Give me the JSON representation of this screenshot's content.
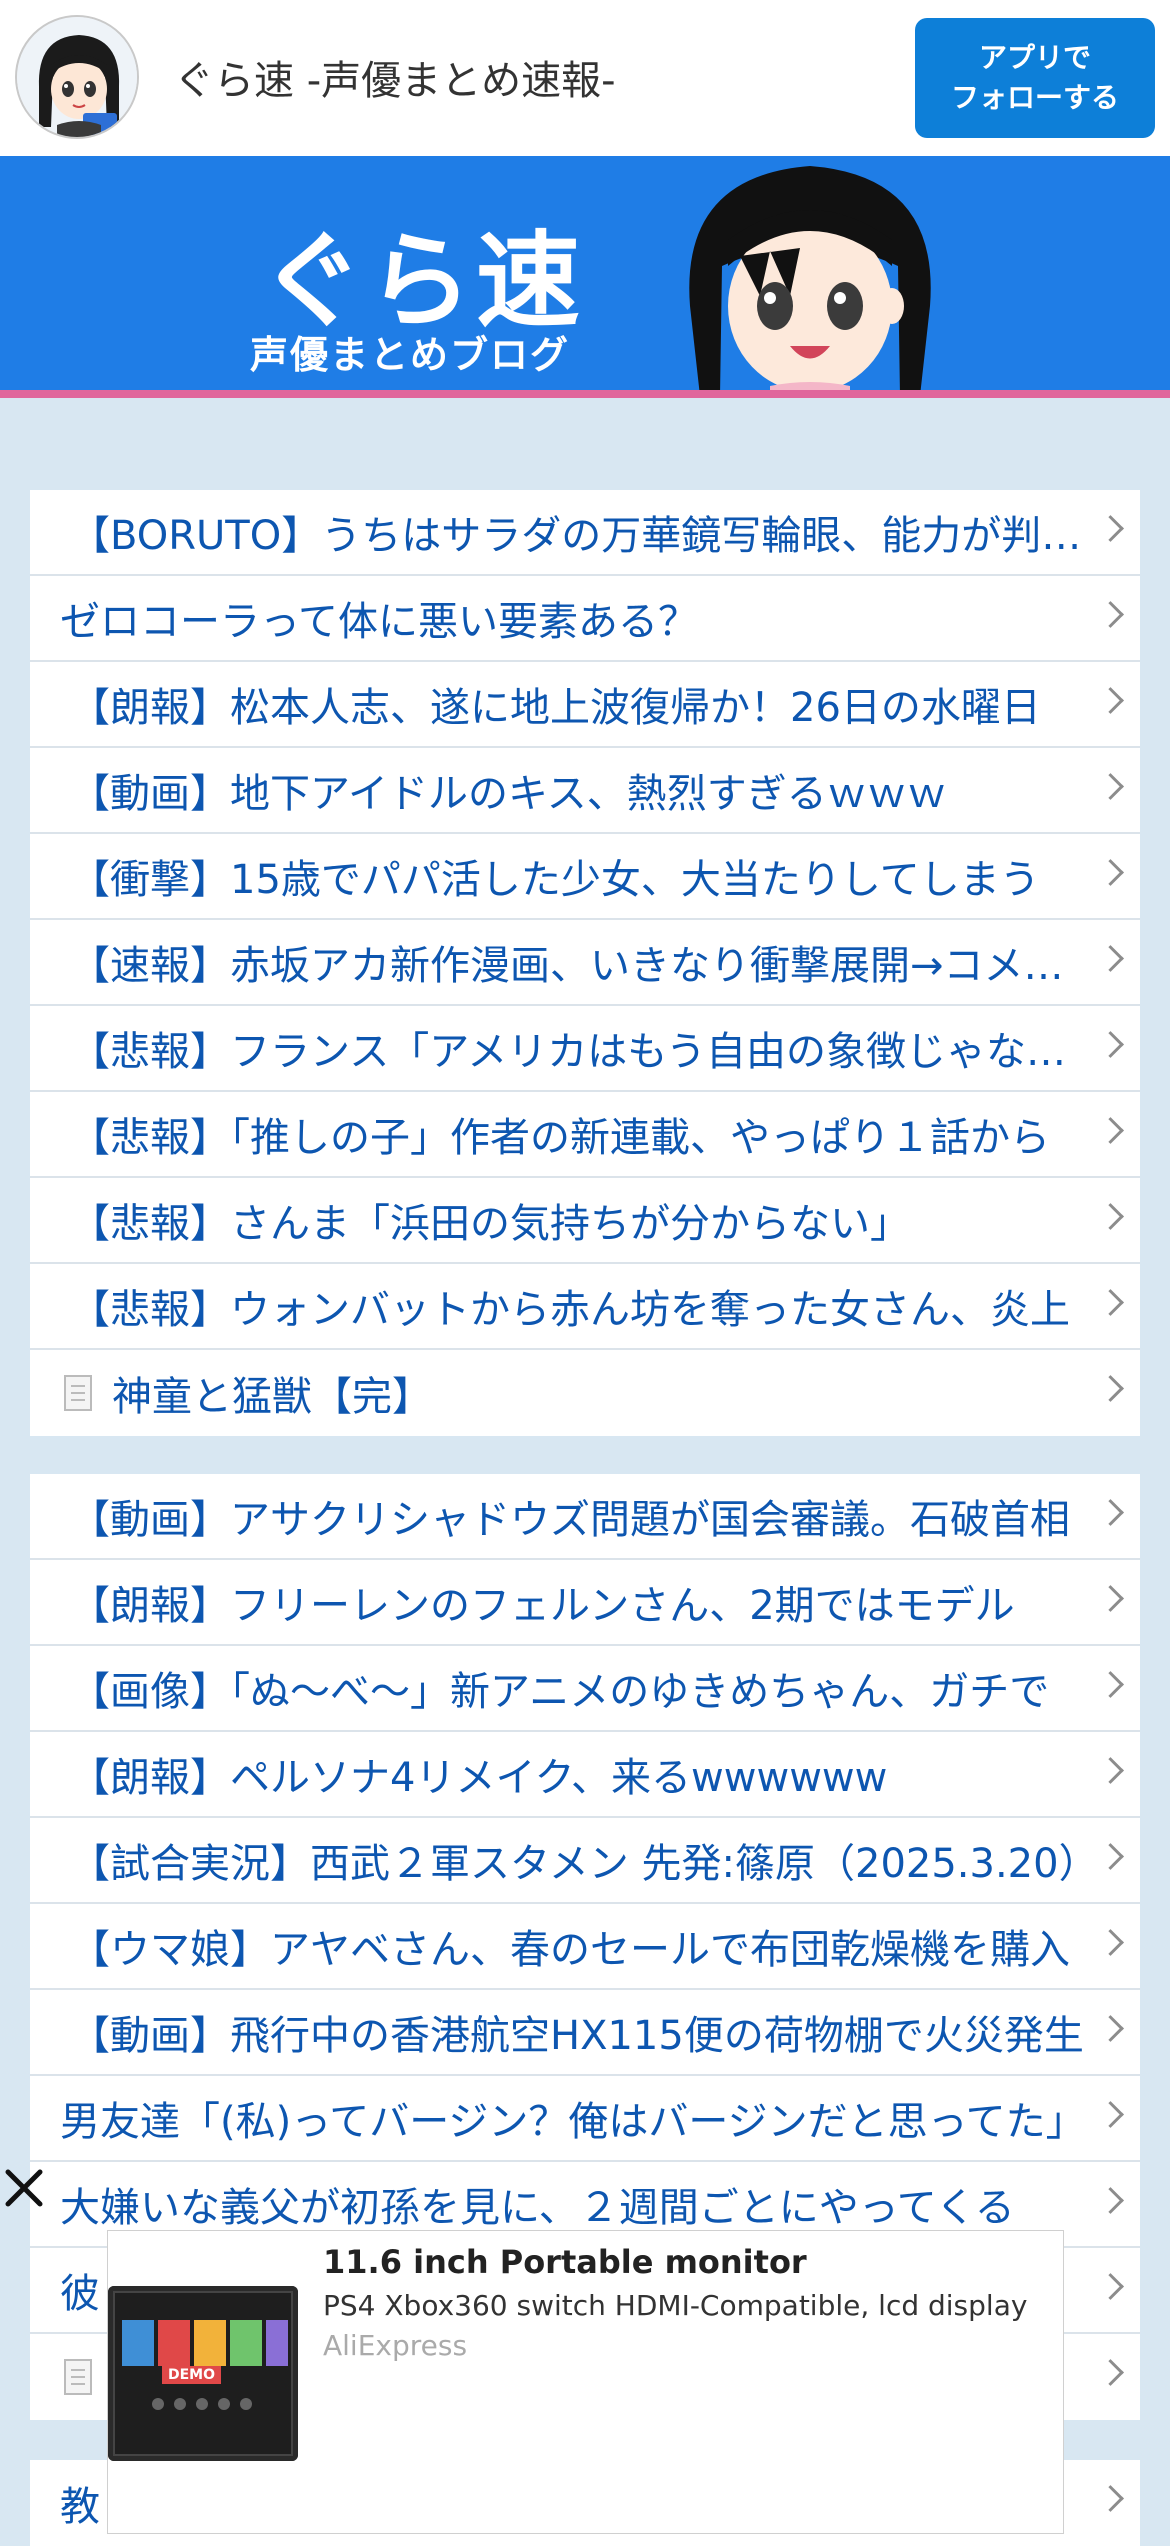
{
  "header": {
    "site_title": "ぐら速 -声優まとめ速報-",
    "follow_line1": "アプリで",
    "follow_line2": "フォローする"
  },
  "banner": {
    "logo_text": "ぐら速",
    "subtitle": "声優まとめブログ"
  },
  "list1": [
    "【BORUTO】うちはサラダの万華鏡写輪眼、能力が判明する",
    "ゼロコーラって体に悪い要素ある？",
    "【朗報】松本人志、遂に地上波復帰か！26日の水曜日",
    "【動画】地下アイドルのキス、熱烈すぎるｗｗｗ",
    "【衝撃】15歳でパパ活した少女、大当たりしてしまう",
    "【速報】赤坂アカ新作漫画、いきなり衝撃展開→コメント欄",
    "【悲報】フランス「アメリカはもう自由の象徴じゃない」",
    "【悲報】「推しの子」作者の新連載、やっぱり１話から",
    "【悲報】さんま「浜田の気持ちが分からない」",
    "【悲報】ウォンバットから赤ん坊を奪った女さん、炎上",
    "神童と猛獣【完】"
  ],
  "list2": [
    "【動画】アサクリシャドウズ問題が国会審議。石破首相",
    "【朗報】フリーレンのフェルンさん、2期ではモデル",
    "【画像】「ぬ〜べ〜」新アニメのゆきめちゃん、ガチで",
    "【朗報】ペルソナ4リメイク、来るwwwwww",
    "【試合実況】西武２軍スタメン 先発:篠原（2025.3.20）",
    "【ウマ娘】アヤベさん、春のセールで布団乾燥機を購入",
    "【動画】飛行中の香港航空HX115便の荷物棚で火災発生",
    "男友達「(私)ってバージン？俺はバージンだと思ってた」",
    "大嫌いな義父が初孫を見に、２週間ごとにやってくる",
    "彼",
    ""
  ],
  "list3": [
    "教"
  ],
  "ad": {
    "title": "11.6 inch Portable monitor",
    "description": "PS4 Xbox360 switch HDMI-Compatible, lcd display",
    "source": "AliExpress",
    "image_text": "DEMO"
  },
  "colors": {
    "link": "#0d56b0",
    "banner": "#1f7de6",
    "accent_pink": "#e0669c",
    "follow_button": "#0d7fd8",
    "page_bg": "#d8e7f2"
  }
}
